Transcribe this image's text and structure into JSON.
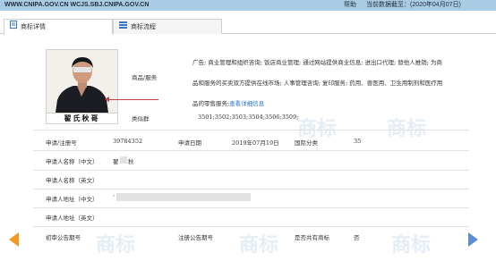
{
  "header": {
    "urls": "WWW.CNIPA.GOV.CN WCJS.SBJ.CNIPA.GOV.CN",
    "help": "帮助",
    "date_label": "当前数据截至：(2020年04月07日)"
  },
  "tabs": [
    {
      "label": "商标详情",
      "icon": "document-icon",
      "active": true
    },
    {
      "label": "商标流程",
      "icon": "list-icon",
      "active": false
    }
  ],
  "photo": {
    "caption": "翟氏秋哥"
  },
  "goods": {
    "label": "商品/服务",
    "text": "广告; 商业管理和组织咨询; 饭店商业管理; 通过网站提供商业信息; 进出口代理; 替他人推销; 为商品和服务的买卖双方提供在线市场; 人事管理咨询; 复印服务; 药用、兽医用、卫生用制剂和医疗用品的零售服务;",
    "link": "查看详细信息"
  },
  "similar_group": {
    "label": "类似群",
    "value": "3501;3502;3503;3504;3506;3509;"
  },
  "fields": {
    "reg_no_label": "申请/注册号",
    "reg_no": "39784352",
    "apply_date_label": "申请日期",
    "apply_date": "2019年07月19日",
    "class_label": "国际分类",
    "class_value": "35",
    "applicant_cn_label": "申请人名称（中文）",
    "applicant_cn": "翟",
    "applicant_cn_tail": "秋",
    "applicant_en_label": "申请人名称（英文）",
    "address_cn_label": "申请人地址（中文）",
    "address_cn": "‘",
    "address_en_label": "申请人地址（英文）",
    "prelim_label": "初审公告期号",
    "reg_pub_label": "注册公告期号",
    "shared_label": "是否共有商标",
    "shared_value": "否"
  },
  "watermark_text": "商标"
}
